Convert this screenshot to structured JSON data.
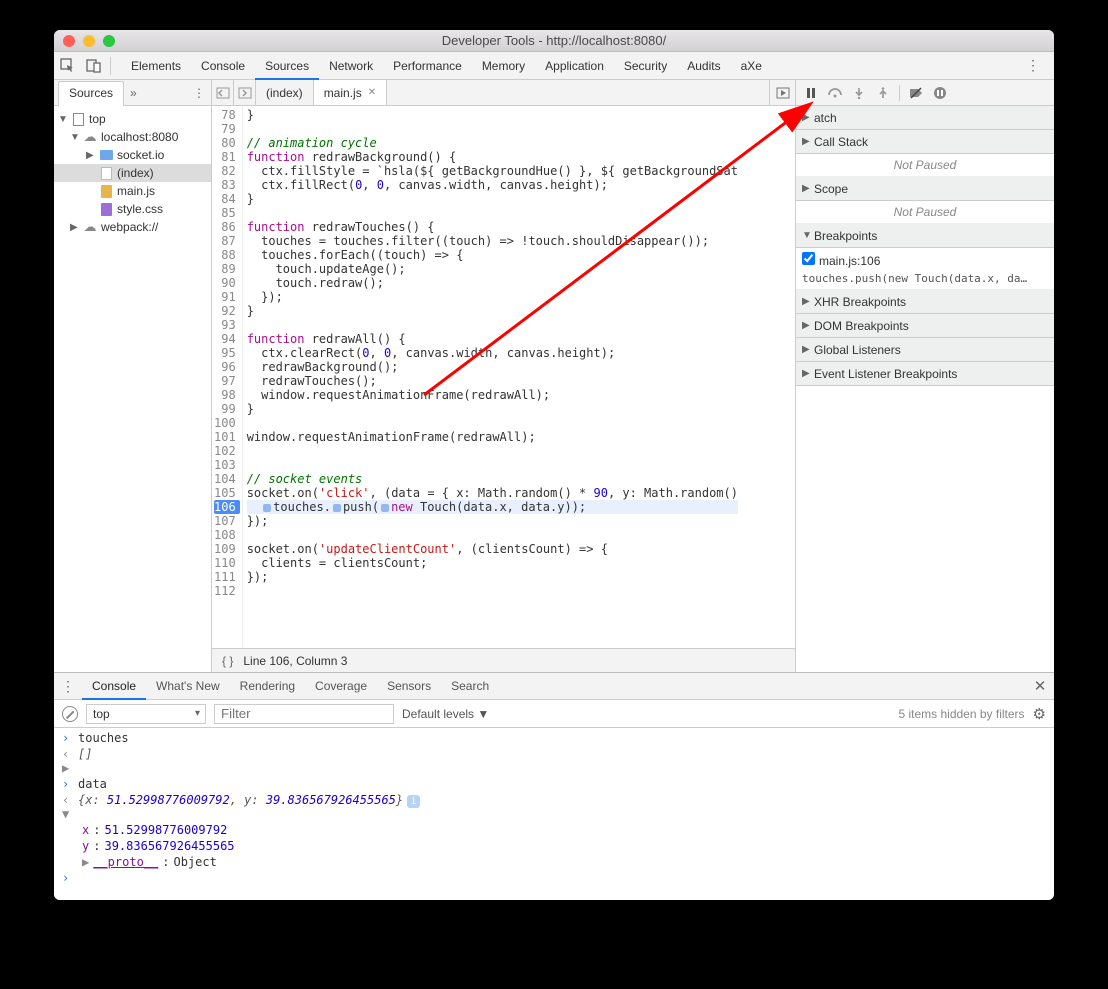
{
  "window": {
    "title": "Developer Tools - http://localhost:8080/"
  },
  "mainTabs": [
    "Elements",
    "Console",
    "Sources",
    "Network",
    "Performance",
    "Memory",
    "Application",
    "Security",
    "Audits",
    "aXe"
  ],
  "mainTabActive": "Sources",
  "sourcesSidebar": {
    "tab": "Sources",
    "tree": {
      "top": "top",
      "host": "localhost:8080",
      "folder1": "socket.io",
      "file_index": "(index)",
      "file_main": "main.js",
      "file_style": "style.css",
      "webpack": "webpack://"
    }
  },
  "fileTabs": {
    "index": "(index)",
    "main": "main.js"
  },
  "code": {
    "startLine": 78,
    "bpLine": 106,
    "lines": [
      "}",
      "",
      "// animation cycle",
      "function redrawBackground() {",
      "  ctx.fillStyle = `hsla(${ getBackgroundHue() }, ${ getBackgroundSat",
      "  ctx.fillRect(0, 0, canvas.width, canvas.height);",
      "}",
      "",
      "function redrawTouches() {",
      "  touches = touches.filter((touch) => !touch.shouldDisappear());",
      "  touches.forEach((touch) => {",
      "    touch.updateAge();",
      "    touch.redraw();",
      "  });",
      "}",
      "",
      "function redrawAll() {",
      "  ctx.clearRect(0, 0, canvas.width, canvas.height);",
      "  redrawBackground();",
      "  redrawTouches();",
      "  window.requestAnimationFrame(redrawAll);",
      "}",
      "",
      "window.requestAnimationFrame(redrawAll);",
      "",
      "",
      "// socket events",
      "socket.on('click', (data = { x: Math.random() * 90, y: Math.random()",
      "  touches.push(new Touch(data.x, data.y));",
      "});",
      "",
      "socket.on('updateClientCount', (clientsCount) => {",
      "  clients = clientsCount;",
      "});",
      ""
    ]
  },
  "statusBar": {
    "format": "{ }",
    "pos": "Line 106, Column 3"
  },
  "debugger": {
    "panes": {
      "watch": "atch",
      "callstack": "Call Stack",
      "callstack_body": "Not Paused",
      "scope": "Scope",
      "scope_body": "Not Paused",
      "breakpoints": "Breakpoints",
      "bp_file": "main.js:106",
      "bp_code": "touches.push(new Touch(data.x, da…",
      "xhr": "XHR Breakpoints",
      "dom": "DOM Breakpoints",
      "global": "Global Listeners",
      "event": "Event Listener Breakpoints"
    }
  },
  "drawer": {
    "tabs": [
      "Console",
      "What's New",
      "Rendering",
      "Coverage",
      "Sensors",
      "Search"
    ],
    "active": "Console",
    "context": "top",
    "filterPlaceholder": "Filter",
    "levels": "Default levels ▼",
    "hidden": "5 items hidden by filters"
  },
  "console": {
    "l1": "touches",
    "l2": "[]",
    "l3": "data",
    "l4_obj": "{x: 51.52998776009792, y: 39.836567926455565}",
    "l5_k": "x",
    "l5_v": "51.52998776009792",
    "l6_k": "y",
    "l6_v": "39.836567926455565",
    "l7": "__proto__",
    "l7_v": "Object"
  }
}
